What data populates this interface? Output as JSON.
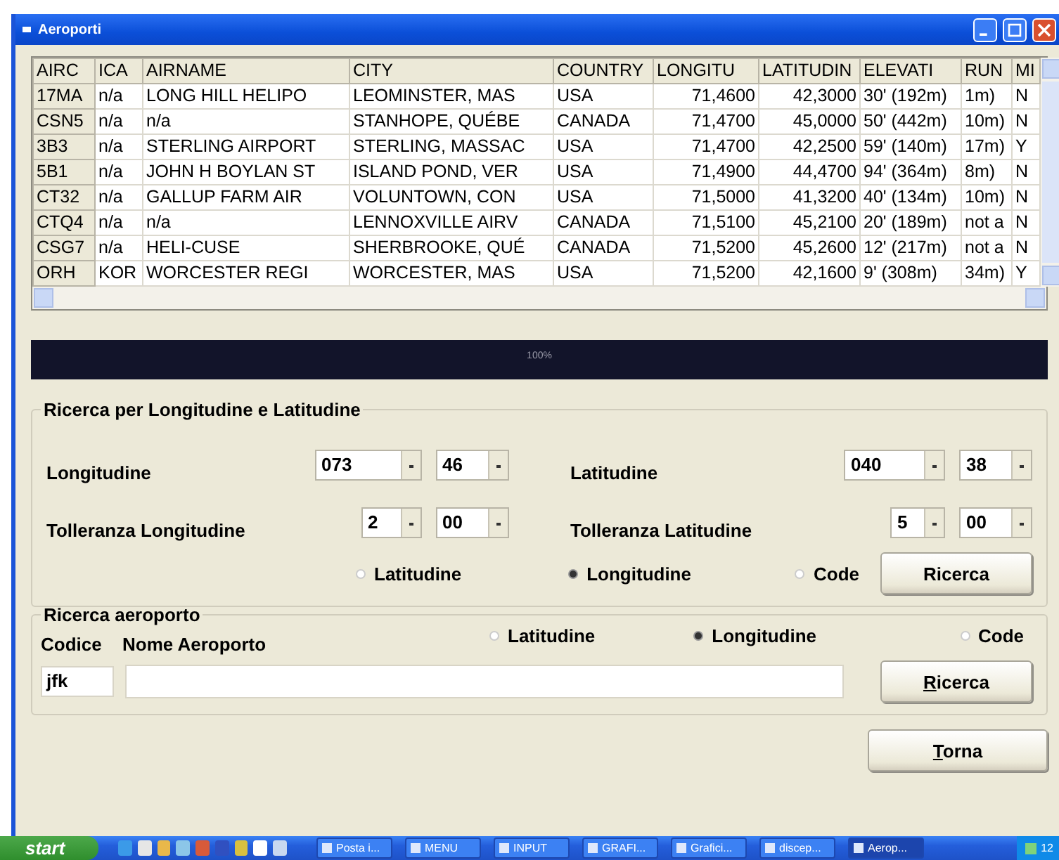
{
  "window": {
    "title": "Aeroporti"
  },
  "table": {
    "columns": [
      {
        "label": "AIRC",
        "kind": "code"
      },
      {
        "label": "ICA",
        "kind": "text"
      },
      {
        "label": "AIRNAME",
        "kind": "text"
      },
      {
        "label": "CITY",
        "kind": "text"
      },
      {
        "label": "COUNTRY",
        "kind": "text"
      },
      {
        "label": "LONGITU",
        "kind": "number"
      },
      {
        "label": "LATITUDIN",
        "kind": "number"
      },
      {
        "label": "ELEVATI",
        "kind": "text"
      },
      {
        "label": "RUN",
        "kind": "text"
      },
      {
        "label": "MI",
        "kind": "text"
      }
    ],
    "rows": [
      {
        "cells": [
          "17MA",
          "n/a",
          "LONG HILL HELIPO",
          "LEOMINSTER, MAS",
          "USA",
          "71,4600",
          "42,3000",
          "30' (192m)",
          "1m)",
          "N"
        ]
      },
      {
        "cells": [
          "CSN5",
          "n/a",
          "n/a",
          "STANHOPE, QUÉBE",
          "CANADA",
          "71,4700",
          "45,0000",
          "50' (442m)",
          "10m)",
          "N"
        ]
      },
      {
        "cells": [
          "3B3",
          "n/a",
          "STERLING AIRPORT",
          "STERLING, MASSAC",
          "USA",
          "71,4700",
          "42,2500",
          "59' (140m)",
          "17m)",
          "Y"
        ]
      },
      {
        "cells": [
          "5B1",
          "n/a",
          "JOHN H BOYLAN ST",
          "ISLAND POND, VER",
          "USA",
          "71,4900",
          "44,4700",
          "94' (364m)",
          "8m)",
          "N"
        ]
      },
      {
        "cells": [
          "CT32",
          "n/a",
          "GALLUP FARM AIR",
          "VOLUNTOWN, CON",
          "USA",
          "71,5000",
          "41,3200",
          "40' (134m)",
          "10m)",
          "N"
        ]
      },
      {
        "cells": [
          "CTQ4",
          "n/a",
          "n/a",
          "LENNOXVILLE AIRV",
          "CANADA",
          "71,5100",
          "45,2100",
          "20' (189m)",
          "not a",
          "N"
        ]
      },
      {
        "cells": [
          "CSG7",
          "n/a",
          "HELI-CUSE",
          "SHERBROOKE, QUÉ",
          "CANADA",
          "71,5200",
          "45,2600",
          "12' (217m)",
          "not a",
          "N"
        ]
      },
      {
        "cells": [
          "ORH",
          "KOR",
          "WORCESTER REGI",
          "WORCESTER, MAS",
          "USA",
          "71,5200",
          "42,1600",
          "9' (308m)",
          "34m)",
          "Y"
        ]
      }
    ]
  },
  "progress": {
    "level": 1,
    "label": "100%"
  },
  "coord_search": {
    "title": "Ricerca per Longitudine e Latitudine",
    "fields": [
      {
        "label": "Longitudine",
        "combos": [
          "073",
          "46"
        ]
      },
      {
        "label": "Latitudine",
        "combos": [
          "040",
          "38"
        ]
      },
      {
        "label": "Tolleranza Longitudine",
        "combos": [
          "2",
          "00"
        ]
      },
      {
        "label": "Tolleranza Latitudine",
        "combos": [
          "5",
          "00"
        ]
      }
    ],
    "sort_options": [
      {
        "label": "Latitudine",
        "selected": false
      },
      {
        "label": "Longitudine",
        "selected": true
      },
      {
        "label": "Code",
        "selected": false
      }
    ],
    "search_button": {
      "label": "Ricerca",
      "mnemonic": false
    }
  },
  "airport_search": {
    "title": "Ricerca aeroporto",
    "code_label": "Codice",
    "code_value": "jfk",
    "name_label": "Nome Aeroporto",
    "sort_options": [
      {
        "label": "Latitudine",
        "selected": false
      },
      {
        "label": "Longitudine",
        "selected": true
      },
      {
        "label": "Code",
        "selected": false
      }
    ],
    "search_button": {
      "label": "Ricerca",
      "mnemonic": true
    }
  },
  "back_button": {
    "label": "Torna",
    "mnemonic": true
  },
  "taskbar": {
    "start": "start",
    "tasks": [
      {
        "label": "Posta i...",
        "selected": false
      },
      {
        "label": "MENU",
        "selected": false
      },
      {
        "label": "INPUT",
        "selected": false
      },
      {
        "label": "GRAFI...",
        "selected": false
      },
      {
        "label": "Grafici...",
        "selected": false
      },
      {
        "label": "discep...",
        "selected": false
      },
      {
        "label": "Aerop...",
        "selected": true
      }
    ],
    "clock": "12"
  }
}
